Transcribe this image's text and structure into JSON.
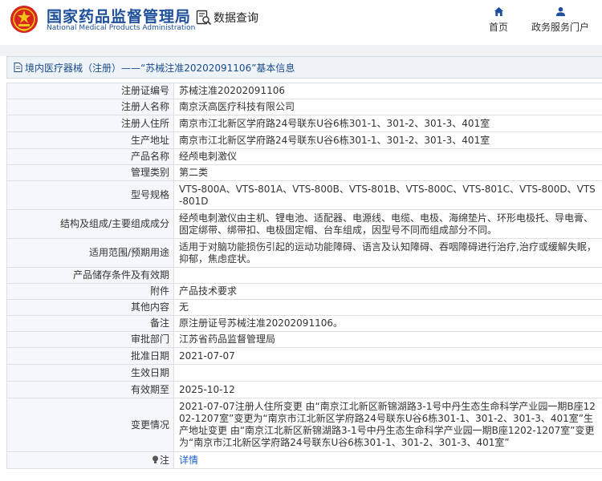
{
  "header": {
    "brand_cn": "国家药品监督管理局",
    "brand_en": "National Medical Products Administration",
    "search_label": "数据查询",
    "nav": {
      "home": "首页",
      "portal": "政务服务门户"
    },
    "accent_color": "#1d4f9a",
    "logo_color": "#d7261e"
  },
  "breadcrumb": "境内医疗器械（注册）——“苏械注准20202091106”基本信息",
  "rows": [
    {
      "label": "注册证编号",
      "value": "苏械注准20202091106"
    },
    {
      "label": "注册人名称",
      "value": "南京沃高医疗科技有限公司"
    },
    {
      "label": "注册人住所",
      "value": "南京市江北新区学府路24号联东U谷6栋301-1、301-2、301-3、401室"
    },
    {
      "label": "生产地址",
      "value": "南京市江北新区学府路24号联东U谷6栋301-1、301-2、301-3、401室"
    },
    {
      "label": "产品名称",
      "value": "经颅电刺激仪"
    },
    {
      "label": "管理类别",
      "value": "第二类"
    },
    {
      "label": "型号规格",
      "value": "VTS-800A、VTS-801A、VTS-800B、VTS-801B、VTS-800C、VTS-801C、VTS-800D、VTS-801D"
    },
    {
      "label": "结构及组成/主要组成成分",
      "value": "经颅电刺激仪由主机、锂电池、适配器、电源线、电缆、电极、海绵垫片、环形电极托、导电膏、固定绑带、绑带扣、电极固定帽、台车组成，因型号不同而组成部分不同。"
    },
    {
      "label": "适用范围/预期用途",
      "value": "适用于对脑功能损伤引起的运动功能障碍、语言及认知障碍、吞咽障碍进行治疗,治疗或缓解失眠，抑郁，焦虑症状。"
    },
    {
      "label": "产品储存条件及有效期",
      "value": ""
    },
    {
      "label": "附件",
      "value": "产品技术要求"
    },
    {
      "label": "其他内容",
      "value": "无"
    },
    {
      "label": "备注",
      "value": "原注册证号苏械注准20202091106。"
    },
    {
      "label": "审批部门",
      "value": "江苏省药品监督管理局"
    },
    {
      "label": "批准日期",
      "value": "2021-07-07"
    },
    {
      "label": "生效日期",
      "value": ""
    },
    {
      "label": "有效期至",
      "value": "2025-10-12"
    },
    {
      "label": "变更情况",
      "value": "2021-07-07注册人住所变更 由“南京江北新区新锦湖路3-1号中丹生态生命科学产业园一期B座1202-1207室”变更为“南京市江北新区学府路24号联东U谷6栋301-1、301-2、301-3、401室”生产地址变更 由“南京江北新区新锦湖路3-1号中丹生态生命科学产业园一期B座1202-1207室”变更为“南京市江北新区学府路24号联东U谷6栋301-1、301-2、301-3、401室”"
    }
  ],
  "note_row": {
    "label": "注",
    "link": "详情"
  }
}
